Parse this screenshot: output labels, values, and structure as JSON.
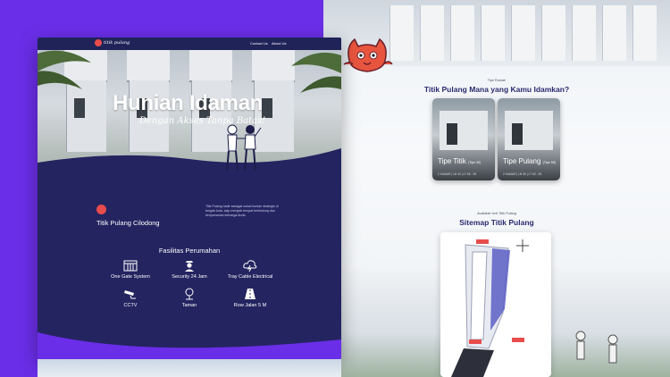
{
  "hero": {
    "title": "Hunian Idaman",
    "subtitle": "Dengan Akses Tanpa Batas!"
  },
  "nav": {
    "logo_text": "titik pulang",
    "links": [
      "Contact Us",
      "About Us"
    ]
  },
  "brand": {
    "name": "Titik Pulang Cilodong",
    "description": "Titik Pulang hadir sebagai solusi hunian strategis di tengah kota, siap menjadi tempat berlindung dan kenyamanan keluarga Anda."
  },
  "facilities": {
    "title": "Fasilitas Perumahan",
    "items": [
      {
        "label": "One Gate System",
        "icon": "gate-icon"
      },
      {
        "label": "Security 24 Jam",
        "icon": "security-guard-icon"
      },
      {
        "label": "Tray Cable Electrical",
        "icon": "cloud-electric-icon"
      },
      {
        "label": "CCTV",
        "icon": "cctv-icon"
      },
      {
        "label": "Taman",
        "icon": "tree-icon"
      },
      {
        "label": "Row Jalan 5 M",
        "icon": "road-icon"
      }
    ]
  },
  "types_section": {
    "kicker": "Tipe Rumah",
    "title": "Titik Pulang Mana yang Kamu Idamkan?",
    "cards": [
      {
        "name": "Tipe Titik",
        "size": "(Tipe 40)",
        "spec": "2 KAMAR | LB 40 | LT 65 - 95"
      },
      {
        "name": "Tipe Pulang",
        "size": "(Tipe 55)",
        "spec": "2 KAMAR | LB 55 | LT 65 - 95"
      }
    ]
  },
  "siteplan": {
    "kicker": "Available Unit Titik Pulang",
    "title": "Sitemap Titik Pulang"
  },
  "colors": {
    "accent_purple": "#6a2ee8",
    "navy": "#242461",
    "brand_red": "#e84c4c"
  }
}
